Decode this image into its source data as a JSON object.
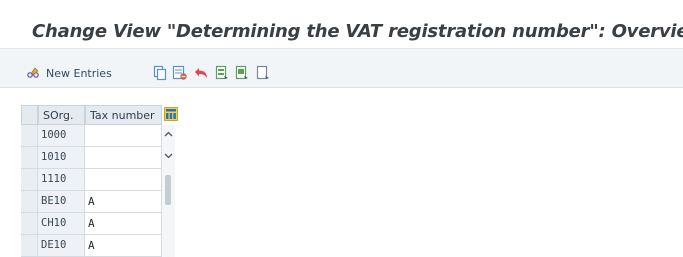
{
  "window": {
    "title": "Change View \"Determining the VAT registration number\": Overview"
  },
  "toolbar": {
    "new_entries_label": "New Entries",
    "icons": [
      "pencil-glasses-icon",
      "copy-icon",
      "delete-icon",
      "undo-icon",
      "select-all-icon",
      "select-block-icon",
      "deselect-all-icon"
    ]
  },
  "table": {
    "columns": [
      "SOrg.",
      "Tax number"
    ],
    "rows": [
      {
        "sorg": "1000",
        "tax": ""
      },
      {
        "sorg": "1010",
        "tax": ""
      },
      {
        "sorg": "1110",
        "tax": ""
      },
      {
        "sorg": "BE10",
        "tax": "A"
      },
      {
        "sorg": "CH10",
        "tax": "A"
      },
      {
        "sorg": "DE10",
        "tax": "A"
      }
    ]
  },
  "colors": {
    "title_text": "#3a3f44",
    "toolbar_bg": "#f2f5f8",
    "header_bg": "#e4eaf0",
    "key_cell_bg": "#eef2f6"
  }
}
